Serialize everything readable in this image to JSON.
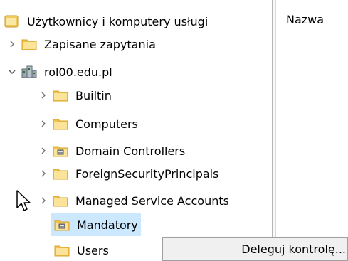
{
  "tree": {
    "root_label": "Użytkownicy i komputery usługi",
    "saved_queries_label": "Zapisane zapytania",
    "domain_label": "rol00.edu.pl",
    "items": [
      {
        "label": "Builtin",
        "icon": "folder-icon"
      },
      {
        "label": "Computers",
        "icon": "folder-icon"
      },
      {
        "label": "Domain Controllers",
        "icon": "ou-folder-icon"
      },
      {
        "label": "ForeignSecurityPrincipals",
        "icon": "folder-icon"
      },
      {
        "label": "Managed Service Accounts",
        "icon": "folder-icon"
      },
      {
        "label": "Mandatory",
        "icon": "ou-folder-icon",
        "selected": true
      },
      {
        "label": "Users",
        "icon": "folder-icon"
      }
    ]
  },
  "list": {
    "column_name": "Nazwa"
  },
  "context_menu": {
    "item_label": "Deleguj kontrolę..."
  },
  "colors": {
    "selection": "#cce8ff",
    "folder": "#f0c14b",
    "folder_dark": "#d9a52a"
  }
}
